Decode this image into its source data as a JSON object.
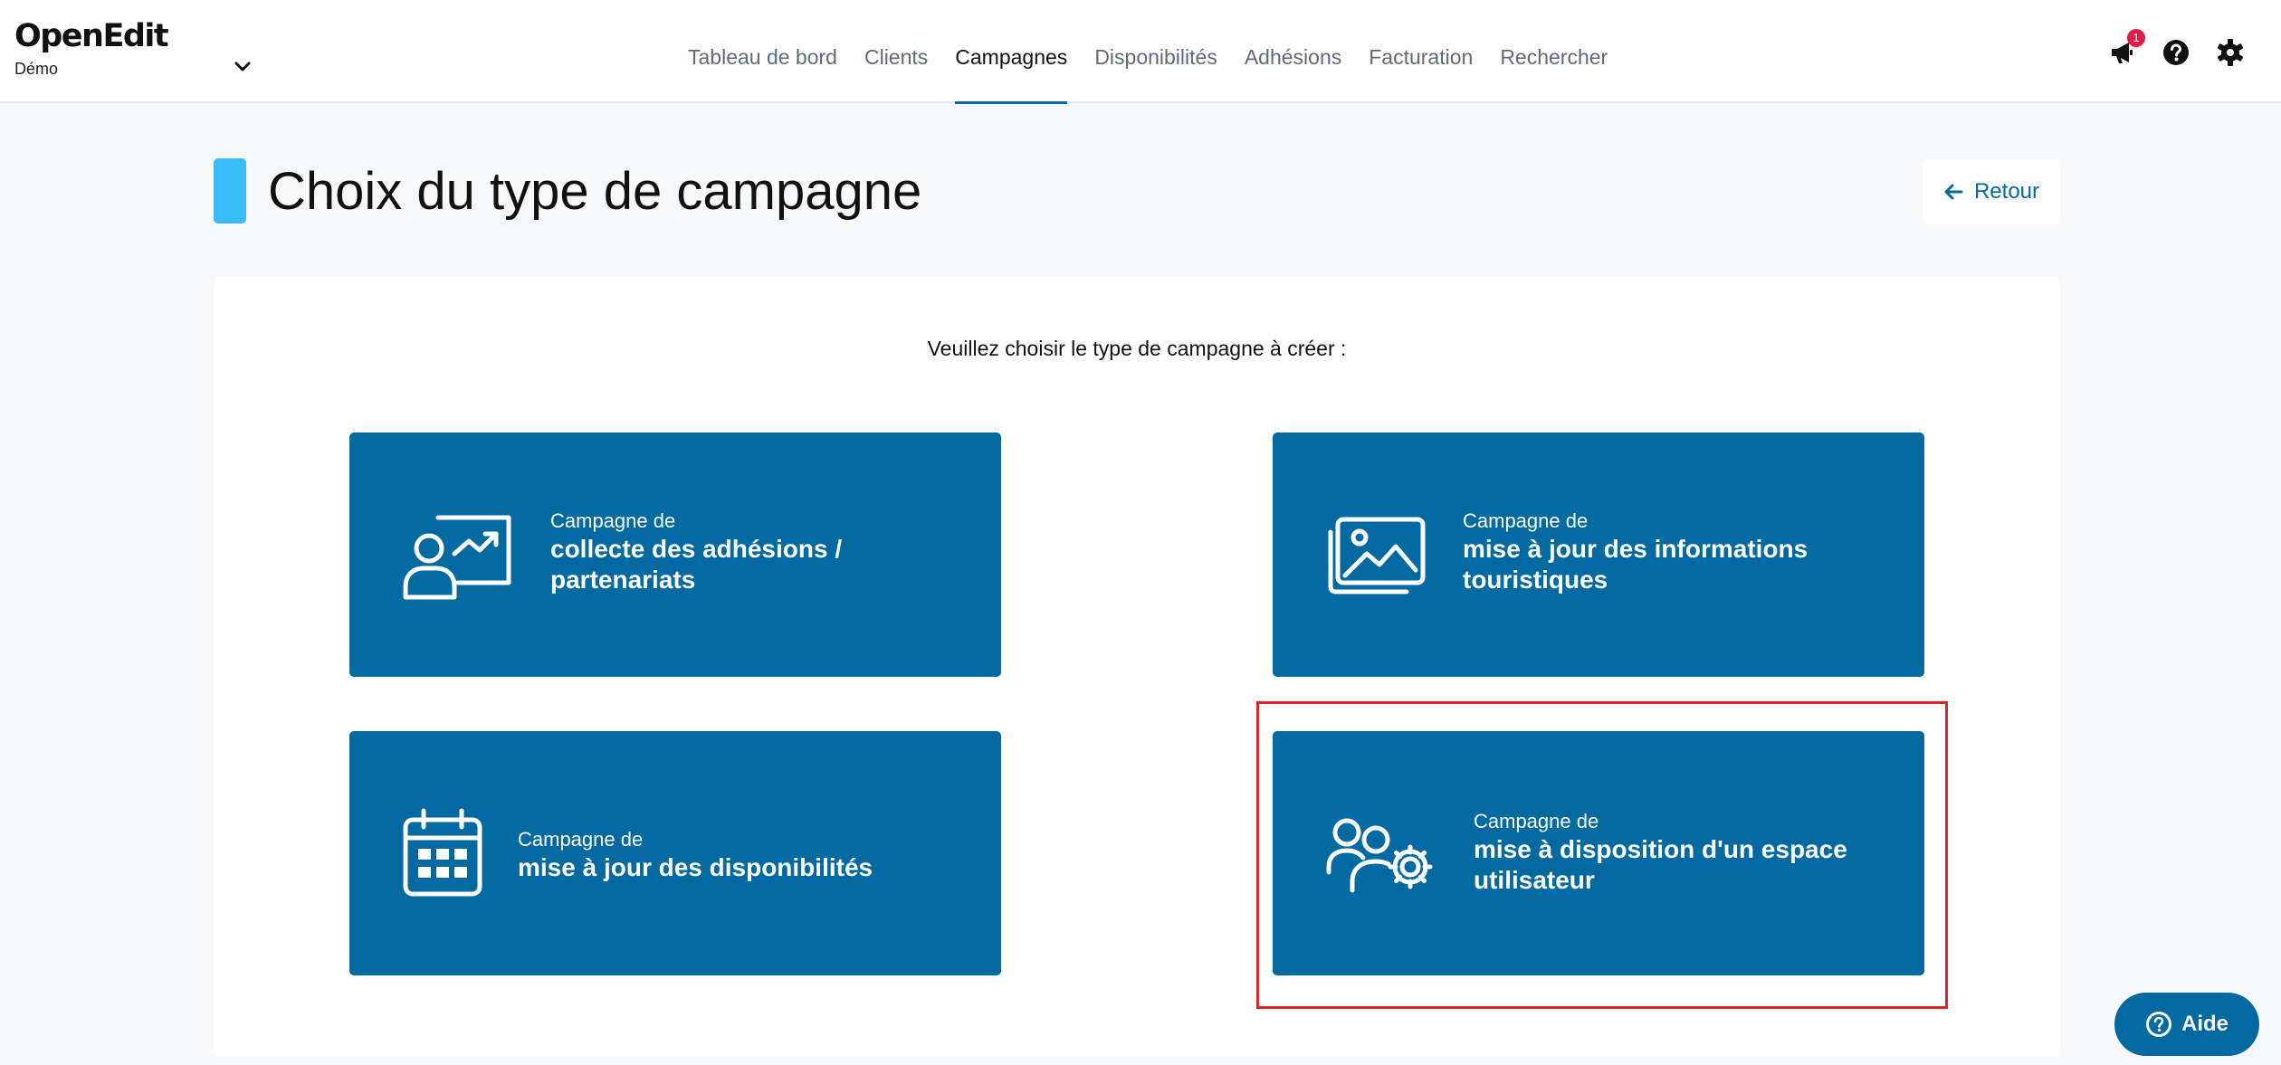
{
  "app": {
    "logo": "OpenEdit",
    "workspace": "Démo"
  },
  "nav": {
    "items": [
      {
        "label": "Tableau de bord",
        "active": false
      },
      {
        "label": "Clients",
        "active": false
      },
      {
        "label": "Campagnes",
        "active": true
      },
      {
        "label": "Disponibilités",
        "active": false
      },
      {
        "label": "Adhésions",
        "active": false
      },
      {
        "label": "Facturation",
        "active": false
      },
      {
        "label": "Rechercher",
        "active": false
      }
    ]
  },
  "notifications": {
    "count": "1"
  },
  "icons": {
    "workspace": "chevron-down-icon",
    "notifications": "megaphone-icon",
    "help": "question-circle-icon",
    "settings": "gear-icon",
    "back": "arrow-left-icon"
  },
  "page": {
    "title": "Choix du type de campagne",
    "back_label": "Retour",
    "prompt": "Veuillez choisir le type de campagne à créer :"
  },
  "cards": [
    {
      "id": "adhesions",
      "prefix": "Campagne de",
      "title": "collecte des adhésions / partenariats",
      "icon": "presentation-chart-icon"
    },
    {
      "id": "infos",
      "prefix": "Campagne de",
      "title": "mise à jour des informations touristiques",
      "icon": "images-icon"
    },
    {
      "id": "dispos",
      "prefix": "Campagne de",
      "title": "mise à jour des disponibilités",
      "icon": "calendar-icon"
    },
    {
      "id": "espace",
      "prefix": "Campagne de",
      "title": "mise à disposition d'un espace utilisateur",
      "icon": "users-gear-icon"
    }
  ],
  "help_button": {
    "label": "Aide",
    "icon": "question-circle-icon"
  },
  "colors": {
    "primary": "#0369a1",
    "accent": "#38bdf8",
    "badge": "#e11d48",
    "highlight": "#dc2626"
  }
}
